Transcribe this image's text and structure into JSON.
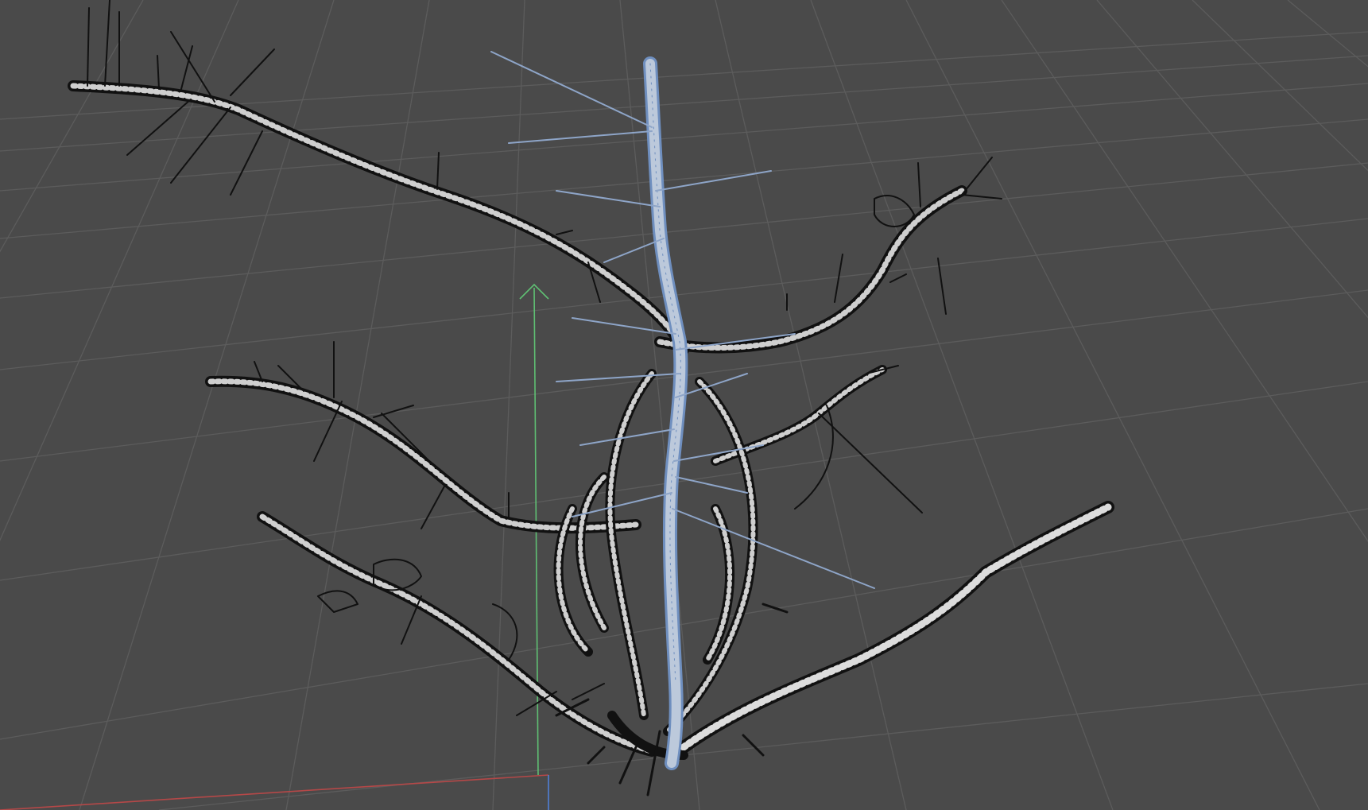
{
  "viewport": {
    "kind": "3d-perspective-viewport",
    "shading": "wireframe-on-shaded",
    "grid_visible": true
  },
  "colors": {
    "background": "#4a4a4a",
    "grid_line": "#5f5f5f",
    "x_axis": "#c24a4a",
    "y_axis": "#5fbf73",
    "z_axis": "#4f7fd6",
    "mesh_light": "#d6d6d6",
    "mesh_dark": "#111111",
    "selected_mesh": "#bcc9db",
    "selected_wire": "#6f8fbf"
  },
  "icons": {
    "gizmo": "transform-gizmo-arrow-icon"
  },
  "scene": {
    "object": "thorny-branch-mesh",
    "selected_object": "center-stem-mesh"
  }
}
